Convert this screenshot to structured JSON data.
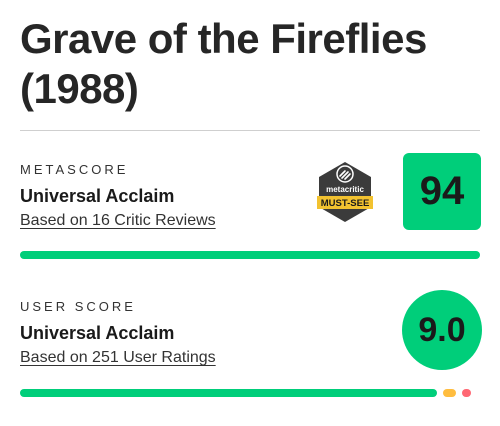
{
  "title": "Grave of the Fireflies (1988)",
  "metascore": {
    "label": "METASCORE",
    "verdict": "Universal Acclaim",
    "basis": "Based on 16 Critic Reviews",
    "score": "94",
    "badge": {
      "brand": "metacritic",
      "text": "MUST-SEE"
    },
    "distribution": {
      "positive": 1.0,
      "mixed": 0,
      "negative": 0
    }
  },
  "user_score": {
    "label": "USER SCORE",
    "verdict": "Universal Acclaim",
    "basis": "Based on 251 User Ratings",
    "score": "9.0",
    "distribution": {
      "positive": 0.93,
      "mixed": 0.03,
      "negative": 0.02
    }
  },
  "colors": {
    "positive": "#00ce7a",
    "mixed": "#ffbd3f",
    "negative": "#ff6874",
    "badge": "#3b3b3b",
    "badge_gold": "#f2c230"
  }
}
